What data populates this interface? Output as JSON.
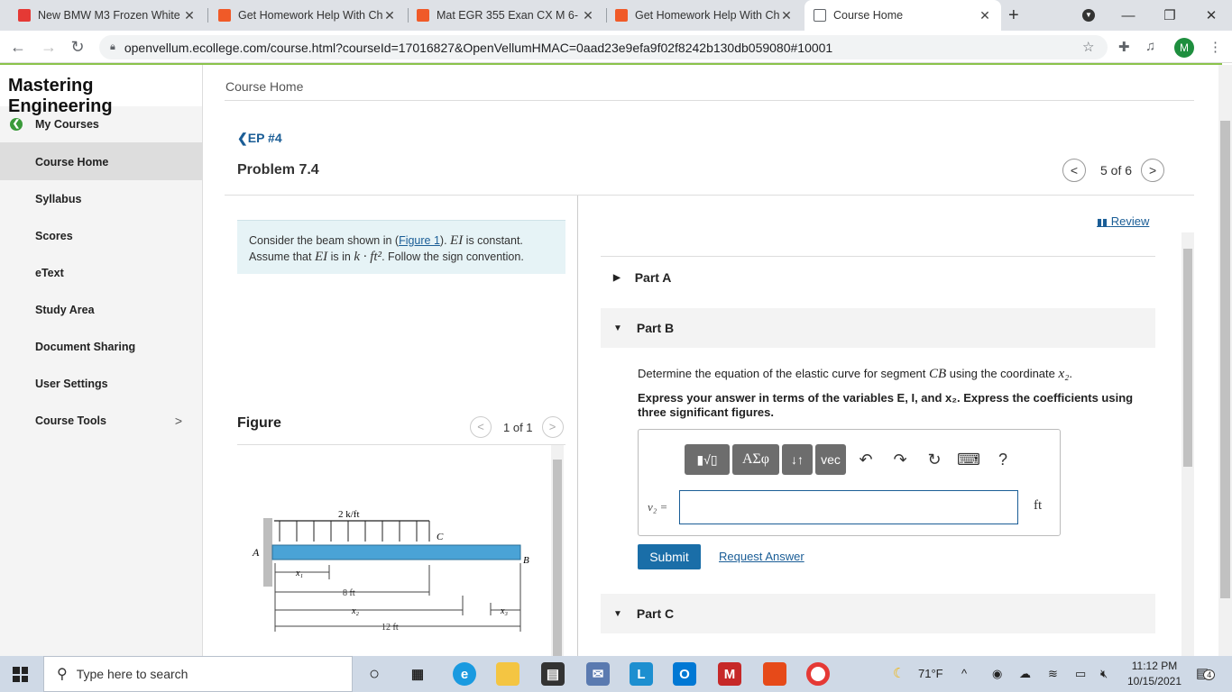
{
  "browser": {
    "tabs": [
      {
        "title": "New BMW M3 Frozen White",
        "fav_color": "#e53935"
      },
      {
        "title": "Get Homework Help With Ch",
        "fav_color": "#f05a28"
      },
      {
        "title": "Mat EGR 355 Exan CX M 6- =",
        "fav_color": "#f05a28"
      },
      {
        "title": "Get Homework Help With Ch",
        "fav_color": "#f05a28"
      },
      {
        "title": "Course Home",
        "fav_color": "#5f6368"
      }
    ],
    "url": "openvellum.ecollege.com/course.html?courseId=17016827&OpenVellumHMAC=0aad23e9efa9f02f8242b130db059080#10001",
    "avatar_letter": "M"
  },
  "sidebar": {
    "brand": "Mastering Engineering",
    "items": [
      {
        "label": "My Courses"
      },
      {
        "label": "Course Home"
      },
      {
        "label": "Syllabus"
      },
      {
        "label": "Scores"
      },
      {
        "label": "eText"
      },
      {
        "label": "Study Area"
      },
      {
        "label": "Document Sharing"
      },
      {
        "label": "User Settings"
      },
      {
        "label": "Course Tools"
      }
    ]
  },
  "main": {
    "breadcrumb": "Course Home",
    "back_link": "EP #4",
    "problem_title": "Problem 7.4",
    "pager": "5 of 6",
    "intro": {
      "t1": "Consider the beam shown in (",
      "link": "Figure 1",
      "t2": "). ",
      "ei1": "EI",
      "t3": " is constant.",
      "t4": "Assume that ",
      "ei2": "EI",
      "t5": " is in ",
      "units": "k · ft²",
      "t6": ". Follow the sign convention."
    },
    "figure": {
      "label": "Figure",
      "pager": "1 of 1",
      "load": "2 k/ft",
      "pt_a": "A",
      "pt_b": "B",
      "pt_c": "C",
      "x1": "x₁",
      "x2": "x₂",
      "x3": "x₃",
      "dim1": "8 ft",
      "dim2": "12 ft"
    }
  },
  "right": {
    "review": "Review",
    "part_a": "Part A",
    "part_b": "Part B",
    "part_c": "Part C",
    "question": {
      "t1": "Determine the equation of the elastic curve for segment ",
      "seg": "CB",
      "t2": " using the coordinate ",
      "coord": "x₂",
      "t3": "."
    },
    "instructions": "Express your answer in terms of the variables E, I, and x₂. Express the coefficients using three significant figures.",
    "toolbar": {
      "greek": "ΑΣφ",
      "arrows": "↓↑",
      "vec": "vec",
      "help": "?"
    },
    "var_label": "v₂ =",
    "input_value": "",
    "unit": "ft",
    "submit": "Submit",
    "request": "Request Answer"
  },
  "taskbar": {
    "search_placeholder": "Type here to search",
    "weather": "71°F",
    "time": "11:12 PM",
    "date": "10/15/2021",
    "notif_count": "4"
  }
}
